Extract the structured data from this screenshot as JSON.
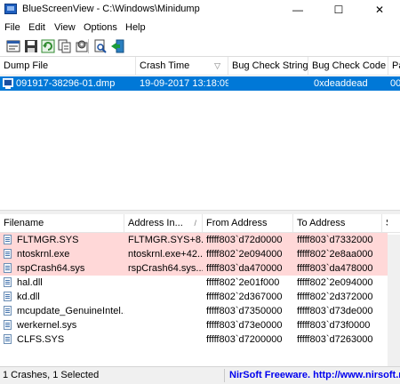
{
  "window": {
    "title": "BlueScreenView - C:\\Windows\\Minidump",
    "minimize": "—",
    "maximize": "☐",
    "close": "✕"
  },
  "menu": [
    "File",
    "Edit",
    "View",
    "Options",
    "Help"
  ],
  "toolbar_icons": [
    "properties-icon",
    "save-icon",
    "refresh-icon",
    "copy-icon",
    "advanced-options-icon",
    "find-icon",
    "exit-icon"
  ],
  "dumps": {
    "columns": [
      "Dump File",
      "Crash Time",
      "Bug Check String",
      "Bug Check Code",
      "Pa"
    ],
    "sort_indicator": "▽",
    "rows": [
      {
        "dump_file": "091917-38296-01.dmp",
        "crash_time": "19-09-2017 13:18:09",
        "bug_check_string": "",
        "bug_check_code": "0xdeaddead",
        "extra": "00",
        "selected": true
      }
    ]
  },
  "drivers": {
    "columns": [
      "Filename",
      "Address In...",
      "From Address",
      "To Address",
      "S"
    ],
    "sort_indicator": "/",
    "rows": [
      {
        "filename": "FLTMGR.SYS",
        "address_in": "FLTMGR.SYS+8...",
        "from": "fffff803`d72d0000",
        "to": "fffff803`d7332000",
        "highlight": true
      },
      {
        "filename": "ntoskrnl.exe",
        "address_in": "ntoskrnl.exe+42...",
        "from": "fffff802`2e094000",
        "to": "fffff802`2e8aa000",
        "highlight": true
      },
      {
        "filename": "rspCrash64.sys",
        "address_in": "rspCrash64.sys...",
        "from": "fffff803`da470000",
        "to": "fffff803`da478000",
        "highlight": true
      },
      {
        "filename": "hal.dll",
        "address_in": "",
        "from": "fffff802`2e01f000",
        "to": "fffff802`2e094000",
        "highlight": false
      },
      {
        "filename": "kd.dll",
        "address_in": "",
        "from": "fffff802`2d367000",
        "to": "fffff802`2d372000",
        "highlight": false
      },
      {
        "filename": "mcupdate_GenuineIntel....",
        "address_in": "",
        "from": "fffff803`d7350000",
        "to": "fffff803`d73de000",
        "highlight": false
      },
      {
        "filename": "werkernel.sys",
        "address_in": "",
        "from": "fffff803`d73e0000",
        "to": "fffff803`d73f0000",
        "highlight": false
      },
      {
        "filename": "CLFS.SYS",
        "address_in": "",
        "from": "fffff803`d7200000",
        "to": "fffff803`d7263000",
        "highlight": false
      }
    ]
  },
  "status": {
    "left": "1 Crashes, 1 Selected",
    "right": "NirSoft Freeware.  http://www.nirsoft.net"
  },
  "colors": {
    "selection": "#0078d7",
    "highlight_row": "#ffd8d8",
    "link": "#0000ee"
  }
}
